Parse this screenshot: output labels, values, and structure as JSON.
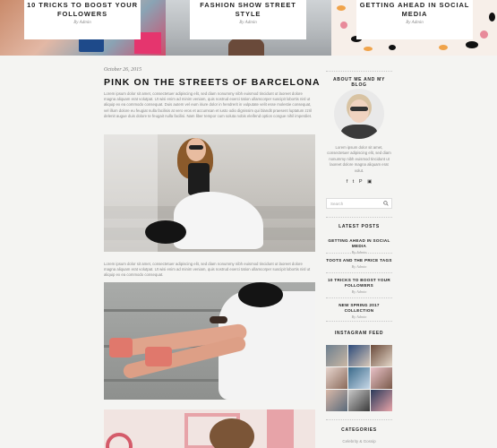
{
  "featured": [
    {
      "title": "10 Tricks to Boost Your Followers",
      "by": "By Admin"
    },
    {
      "title": "Fashion Show Street Style",
      "by": "By Admin"
    },
    {
      "title": "Getting Ahead in Social Media",
      "by": "By Admin"
    }
  ],
  "post": {
    "date": "October 26, 2015",
    "title": "Pink on the Streets of Barcelona",
    "para1": "Lorem ipsum dolor sit amet, consectetuer adipiscing elit, sed diam nonummy nibh euismod tincidunt ut laoreet dolore magna aliquam erat volutpat. Ut wisi enim ad minim veniam, quis nostrud exerci tation ullamcorper suscipit lobortis nisl ut aliquip ex ea commodo consequat. Duis autem vel eum iriure dolor in hendrerit in vulputate velit esse molestie consequat, vel illum dolore eu feugiat nulla facilisis at vero eros et accumsan et iusto odio dignissim qui blandit praesent luptatum zzril delenit augue duis dolore te feugait nulla facilisi. Nam liber tempor cum soluta nobis eleifend option congue nihil imperdiet.",
    "para2": "Lorem ipsum dolor sit amet, consectetuer adipiscing elit, sed diam nonummy nibh euismod tincidunt ut laoreet dolore magna aliquam erat volutpat. Ut wisi enim ad minim veniam, quis nostrud exerci tation ullamcorper suscipit lobortis nisl ut aliquip ex ea commodo consequat."
  },
  "sidebar": {
    "about_heading": "About Me and My Blog",
    "bio": "Lorem ipsum dolor sit amet, consectetuer adipiscing elit, sed diam nonummy nibh euismod tincidunt ut laoreet dolore magna aliquam erat volut.",
    "social_icons": [
      "facebook-icon",
      "twitter-icon",
      "pinterest-icon",
      "instagram-icon"
    ],
    "social_glyphs": [
      "f",
      "t",
      "P",
      "▣"
    ],
    "search_placeholder": "Search",
    "latest_heading": "Latest Posts",
    "latest": [
      {
        "title": "Getting Ahead in Social Media",
        "by": "By Admin"
      },
      {
        "title": "Toots and the Price Tags",
        "by": "By Admin"
      },
      {
        "title": "10 Tricks to Boost Your Followers",
        "by": "By Admin"
      },
      {
        "title": "New Spring 2017 Collection",
        "by": "By Admin"
      }
    ],
    "instagram_heading": "Instagram Feed",
    "categories_heading": "Categories",
    "categories": [
      "Celebrity & Gossip"
    ]
  },
  "colors": {
    "page_bg": "#f4f4f2",
    "accent_pink": "#e7a3a8",
    "text_dark": "#222222"
  }
}
